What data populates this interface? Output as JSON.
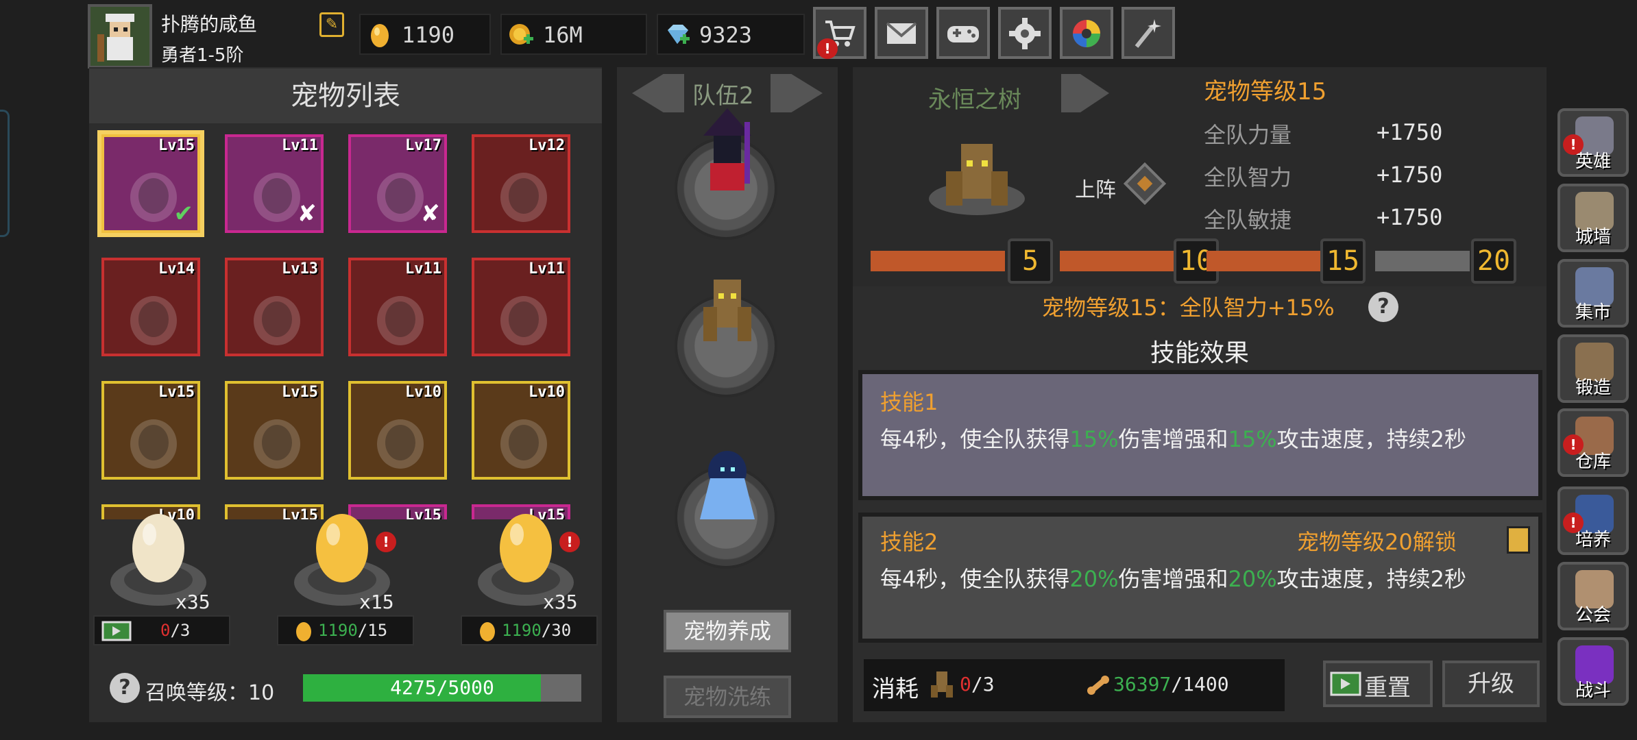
{
  "player": {
    "name": "扑腾的咸鱼",
    "rank": "勇者1-5阶"
  },
  "resources": {
    "gold": "1190",
    "coins": "16M",
    "gems": "9323"
  },
  "colors": {
    "gold": "#f0b830",
    "progress_orange": "#c0582a",
    "green": "#3cb050",
    "red_alert": "#c81e1e"
  },
  "top_buttons": [
    {
      "icon": "cart-icon",
      "alert": "!"
    },
    {
      "icon": "mail-icon"
    },
    {
      "icon": "gamepad-icon"
    },
    {
      "icon": "gear-icon"
    },
    {
      "icon": "color-wheel-icon"
    },
    {
      "icon": "fireworks-icon"
    }
  ],
  "pet_list": {
    "title": "宠物列表",
    "pets": [
      {
        "level": "Lv15",
        "frame": "#f0c040",
        "bg": "#7a2a6a",
        "mark": "✔",
        "mark_color": "#60d060"
      },
      {
        "level": "Lv11",
        "frame": "#c82890",
        "bg": "#7a2a6a",
        "mark": "✘",
        "mark_color": "#ffffff"
      },
      {
        "level": "Lv17",
        "frame": "#c82890",
        "bg": "#7a2a6a",
        "mark": "✘",
        "mark_color": "#ffffff"
      },
      {
        "level": "Lv12",
        "frame": "#c83030",
        "bg": "#6a2020"
      },
      {
        "level": "Lv14",
        "frame": "#c83030",
        "bg": "#6a2020"
      },
      {
        "level": "Lv13",
        "frame": "#c83030",
        "bg": "#6a2020"
      },
      {
        "level": "Lv11",
        "frame": "#c83030",
        "bg": "#6a2020"
      },
      {
        "level": "Lv11",
        "frame": "#c83030",
        "bg": "#6a2020"
      },
      {
        "level": "Lv15",
        "frame": "#e0c030",
        "bg": "#5a3a1a"
      },
      {
        "level": "Lv15",
        "frame": "#e0c030",
        "bg": "#5a3a1a"
      },
      {
        "level": "Lv10",
        "frame": "#e0c030",
        "bg": "#5a3a1a"
      },
      {
        "level": "Lv10",
        "frame": "#e0c030",
        "bg": "#5a3a1a"
      },
      {
        "level": "Lv10",
        "frame": "#e0c030",
        "bg": "#5a3a1a"
      },
      {
        "level": "Lv15",
        "frame": "#e0c030",
        "bg": "#5a3a1a"
      },
      {
        "level": "Lv15",
        "frame": "#c82890",
        "bg": "#7a2a6a"
      },
      {
        "level": "Lv15",
        "frame": "#c82890",
        "bg": "#7a2a6a"
      }
    ]
  },
  "eggs": [
    {
      "count": "x35",
      "cost_used": "0",
      "cost_max": "/3",
      "cost_icon": "video-ad-icon"
    },
    {
      "count": "x15",
      "cost_used": "1190",
      "cost_max": "/15",
      "cost_icon": "gold-egg-icon",
      "alert": "!"
    },
    {
      "count": "x35",
      "cost_used": "1190",
      "cost_max": "/30",
      "cost_icon": "gold-egg-icon",
      "alert": "!"
    }
  ],
  "summon": {
    "label": "召唤等级：10",
    "progress_text": "4275/5000",
    "progress": 0.855
  },
  "team": {
    "label": "队伍2",
    "train_button": "宠物养成",
    "refine_button": "宠物洗练"
  },
  "detail": {
    "pet_name": "永恒之树",
    "deploy_label": "上阵",
    "level_title": "宠物等级15",
    "stats": [
      {
        "name": "全队力量",
        "value": "+1750"
      },
      {
        "name": "全队智力",
        "value": "+1750"
      },
      {
        "name": "全队敏捷",
        "value": "+1750"
      }
    ],
    "milestones": [
      "5",
      "10",
      "15",
      "20"
    ],
    "milestones_reached": 3,
    "bonus_text": "宠物等级15：全队智力+15%",
    "skills_header": "技能效果",
    "skills": [
      {
        "title": "技能1",
        "parts": [
          "每4秒，使全队获得",
          "15%",
          "伤害增强和",
          "15%",
          "攻击速度，持续2秒"
        ]
      },
      {
        "title": "技能2",
        "lock_text": "宠物等级20解锁",
        "parts": [
          "每4秒，使全队获得",
          "20%",
          "伤害增强和",
          "20%",
          "攻击速度，持续2秒"
        ]
      }
    ],
    "cost_label": "消耗",
    "cost_pet_used": "0",
    "cost_pet_max": "/3",
    "cost_bone_have": "36397",
    "cost_bone_need": "/1400",
    "reset_button": "重置",
    "upgrade_button": "升级"
  },
  "side_nav": [
    {
      "label": "英雄",
      "alert": "!",
      "color": "#7a7a8a"
    },
    {
      "label": "城墙",
      "color": "#9a8a70"
    },
    {
      "label": "集市",
      "color": "#6a7aa0"
    },
    {
      "label": "锻造",
      "color": "#8a7050"
    },
    {
      "label": "仓库",
      "alert": "!",
      "color": "#9a6a4a"
    },
    {
      "label": "培养",
      "alert": "!",
      "color": "#3a5a9a"
    },
    {
      "label": "公会",
      "color": "#b09070"
    },
    {
      "label": "战斗",
      "color": "#7a30c0"
    }
  ]
}
